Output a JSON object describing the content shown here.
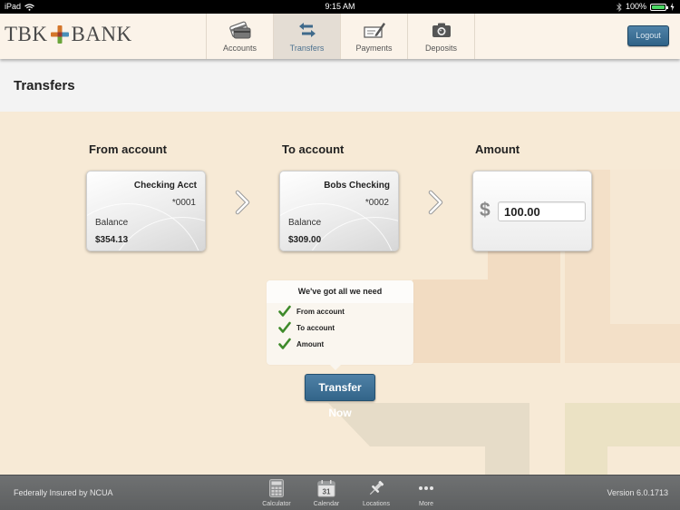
{
  "status_bar": {
    "device": "iPad",
    "time": "9:15 AM",
    "battery": "100%",
    "battery_level_percent": 100
  },
  "header": {
    "logo_left": "TBK",
    "logo_right": "BANK",
    "nav": [
      {
        "label": "Accounts",
        "icon": "credit-cards-icon",
        "active": false
      },
      {
        "label": "Transfers",
        "icon": "transfer-arrows-icon",
        "active": true
      },
      {
        "label": "Payments",
        "icon": "check-pen-icon",
        "active": false
      },
      {
        "label": "Deposits",
        "icon": "camera-icon",
        "active": false
      }
    ],
    "logout_label": "Logout"
  },
  "page": {
    "title": "Transfers"
  },
  "transfer": {
    "from": {
      "section_label": "From account",
      "account_name": "Checking Acct",
      "account_number": "*0001",
      "balance_label": "Balance",
      "balance": "$354.13"
    },
    "to": {
      "section_label": "To account",
      "account_name": "Bobs Checking",
      "account_number": "*0002",
      "balance_label": "Balance",
      "balance": "$309.00"
    },
    "amount": {
      "section_label": "Amount",
      "currency_symbol": "$",
      "value": "100.00"
    },
    "checklist": {
      "heading": "We've got all we need",
      "items": [
        "From account",
        "To account",
        "Amount"
      ]
    },
    "submit_label": "Transfer Now"
  },
  "colors": {
    "accent_blue": "#3a6c90",
    "check_green": "#3e8a2a",
    "background": "#f7ead6"
  },
  "footer": {
    "insured_text": "Federally Insured by NCUA",
    "tools": [
      {
        "label": "Calculator",
        "icon": "calculator-icon"
      },
      {
        "label": "Calendar",
        "icon": "calendar-icon",
        "day": "31"
      },
      {
        "label": "Locations",
        "icon": "pushpin-icon"
      },
      {
        "label": "More",
        "icon": "more-dots-icon"
      }
    ],
    "version": "Version 6.0.1713"
  }
}
